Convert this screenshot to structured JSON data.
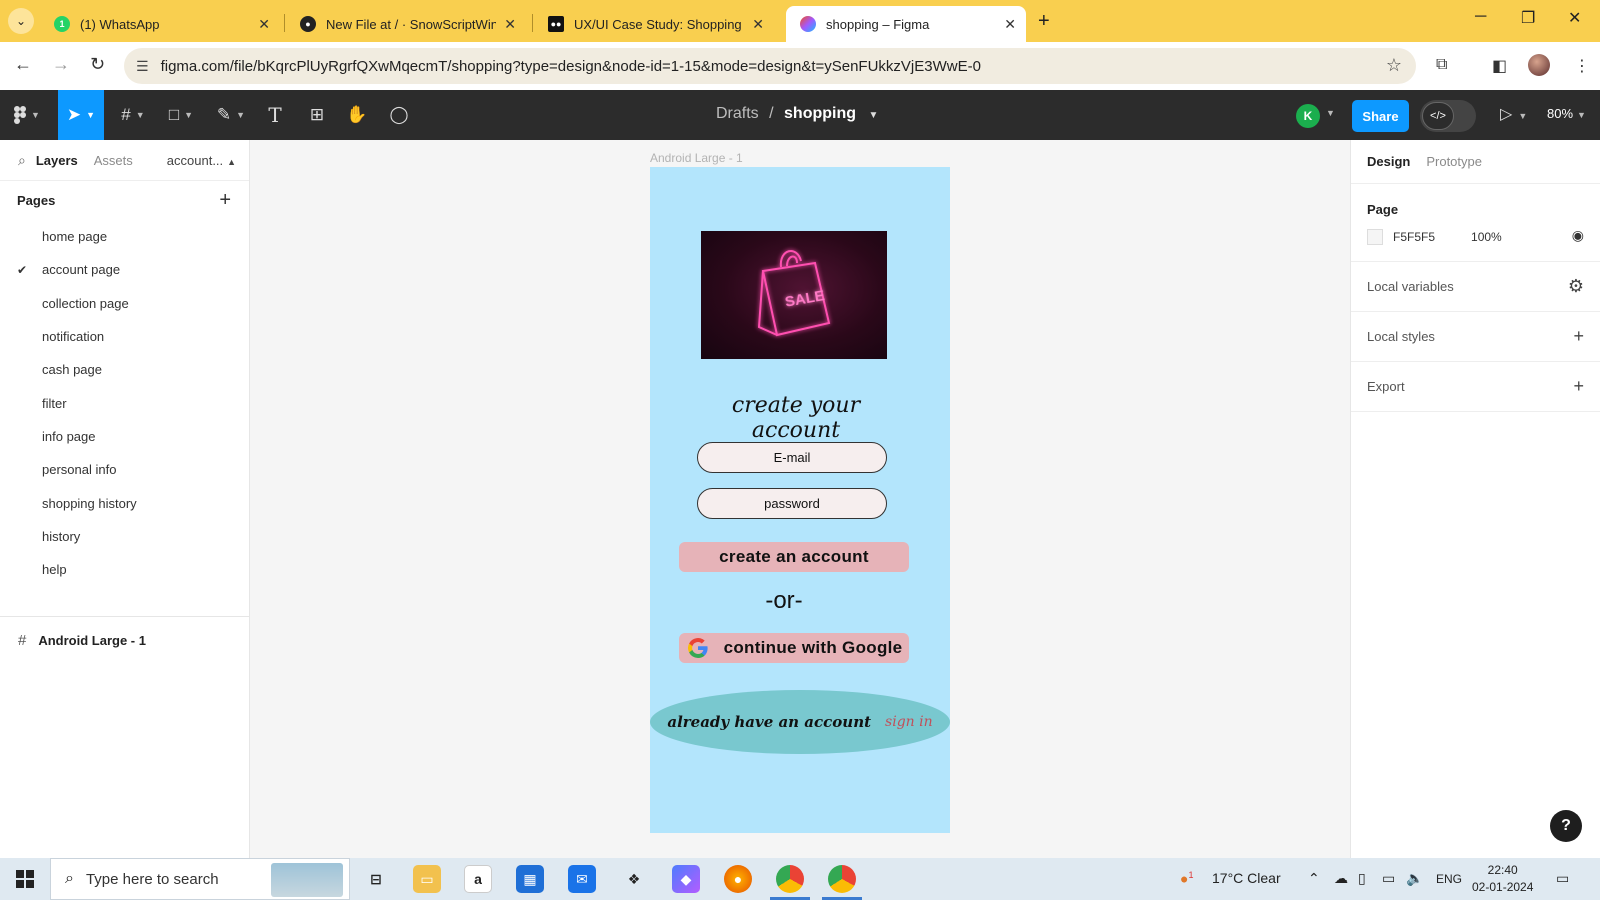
{
  "browser": {
    "tabs": [
      {
        "title": "(1) WhatsApp",
        "icon": "whatsapp-icon"
      },
      {
        "title": "New File at / · SnowScriptWinte",
        "icon": "github-icon"
      },
      {
        "title": "UX/UI Case Study: Shopping Ap",
        "icon": "medium-icon"
      },
      {
        "title": "shopping – Figma",
        "icon": "figma-icon",
        "active": true
      }
    ],
    "url": "figma.com/file/bKqrcPlUyRgrfQXwMqecmT/shopping?type=design&node-id=1-15&mode=design&t=ySenFUkkzVjE3WwE-0",
    "accent": "#f9cf4f"
  },
  "toolbar": {
    "breadcrumb_parent": "Drafts",
    "breadcrumb_sep": "/",
    "file_name": "shopping",
    "avatar_initial": "K",
    "share_label": "Share",
    "zoom": "80%",
    "tools": [
      "figma-menu-icon",
      "move-icon",
      "frame-icon",
      "shape-icon",
      "pen-icon",
      "text-icon",
      "resources-icon",
      "hand-icon",
      "comment-icon"
    ]
  },
  "left_panel": {
    "tab_layers": "Layers",
    "tab_assets": "Assets",
    "current_page": "account...",
    "pages_heading": "Pages",
    "pages": [
      {
        "name": "home page",
        "selected": false
      },
      {
        "name": "account page",
        "selected": true
      },
      {
        "name": "collection page",
        "selected": false
      },
      {
        "name": "notification",
        "selected": false
      },
      {
        "name": "cash page",
        "selected": false
      },
      {
        "name": "filter",
        "selected": false
      },
      {
        "name": "info page",
        "selected": false
      },
      {
        "name": "personal info",
        "selected": false
      },
      {
        "name": "shopping history",
        "selected": false
      },
      {
        "name": "history",
        "selected": false
      },
      {
        "name": "help",
        "selected": false
      }
    ],
    "layer": "Android Large - 1"
  },
  "canvas": {
    "frame_label": "Android Large - 1",
    "frame_bg": "#b3e5fc",
    "image_sale_text": "SALE",
    "title": "create your account",
    "email_placeholder": "E-mail",
    "password_placeholder": "password",
    "create_button": "create an account",
    "or_text": "-or-",
    "google_button": "continue with Google",
    "already_text": "already have an account",
    "signin_text": "sign in"
  },
  "right_panel": {
    "tab_design": "Design",
    "tab_prototype": "Prototype",
    "page_heading": "Page",
    "page_color": "F5F5F5",
    "page_opacity": "100%",
    "local_variables": "Local variables",
    "local_styles": "Local styles",
    "export": "Export",
    "help": "?"
  },
  "taskbar": {
    "search_placeholder": "Type here to search",
    "weather": "17°C  Clear",
    "weather_badge": "1",
    "language": "ENG",
    "time": "22:40",
    "date": "02-01-2024"
  }
}
